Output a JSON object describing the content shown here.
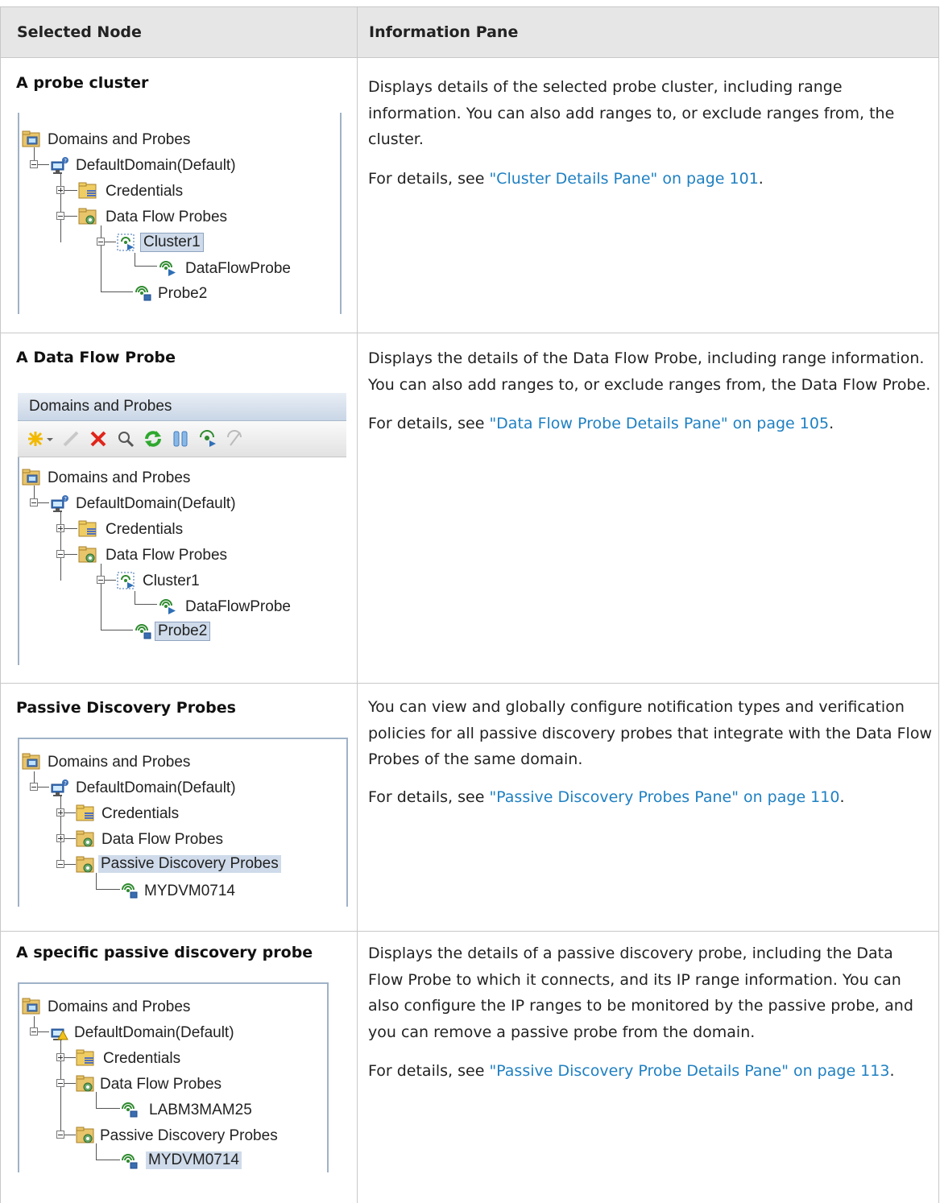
{
  "header": {
    "col1": "Selected Node",
    "col2": "Information Pane"
  },
  "rows": [
    {
      "title": "A probe cluster",
      "description": "Displays details of the selected probe cluster, including range information. You can also add ranges to, or exclude ranges from, the cluster.",
      "details_prefix": "For details, see ",
      "details_link": "\"Cluster Details Pane\" on page 101",
      "details_suffix": ".",
      "tree": [
        "Domains and Probes",
        "DefaultDomain(Default)",
        "Credentials",
        "Data Flow Probes",
        "Cluster1",
        "DataFlowProbe",
        "Probe2"
      ]
    },
    {
      "title": "A Data Flow Probe",
      "description": "Displays the details of the Data Flow Probe, including range information. You can also add ranges to, or exclude ranges from, the Data Flow Probe.",
      "details_prefix": "For details, see ",
      "details_link": "\"Data Flow Probe Details Pane\" on page 105",
      "details_suffix": ".",
      "panel_title": "Domains and Probes",
      "tree": [
        "Domains and Probes",
        "DefaultDomain(Default)",
        "Credentials",
        "Data Flow Probes",
        "Cluster1",
        "DataFlowProbe",
        "Probe2"
      ]
    },
    {
      "title": "Passive Discovery Probes",
      "description": "You can view and globally configure notification types and verification policies for all passive discovery probes that integrate with the Data Flow Probes of the same domain.",
      "details_prefix": "For details, see ",
      "details_link": "\"Passive Discovery Probes Pane\" on page 110",
      "details_suffix": ".",
      "tree": [
        "Domains and Probes",
        "DefaultDomain(Default)",
        "Credentials",
        "Data Flow Probes",
        "Passive Discovery Probes",
        "MYDVM0714"
      ]
    },
    {
      "title": "A specific passive discovery probe",
      "description": "Displays the details of a passive discovery probe, including the Data Flow Probe to which it connects, and its IP range information. You can also configure the IP ranges to be monitored by the passive probe, and you can remove a passive probe from the domain.",
      "details_prefix": "For details, see ",
      "details_link": "\"Passive Discovery Probe Details Pane\" on page 113",
      "details_suffix": ".",
      "tree": [
        "Domains and Probes",
        "DefaultDomain(Default)",
        "Credentials",
        "Data Flow Probes",
        "LABM3MAM25",
        "Passive Discovery Probes",
        "MYDVM0714"
      ]
    }
  ],
  "icons": [
    "domains-folder-icon",
    "domain-computer-icon",
    "credentials-folder-icon",
    "probes-folder-icon",
    "cluster-icon",
    "probe-icon",
    "new-icon",
    "edit-icon",
    "delete-icon",
    "find-icon",
    "refresh-icon",
    "pause-icon",
    "probe-action-icon",
    "probe-disabled-icon"
  ]
}
